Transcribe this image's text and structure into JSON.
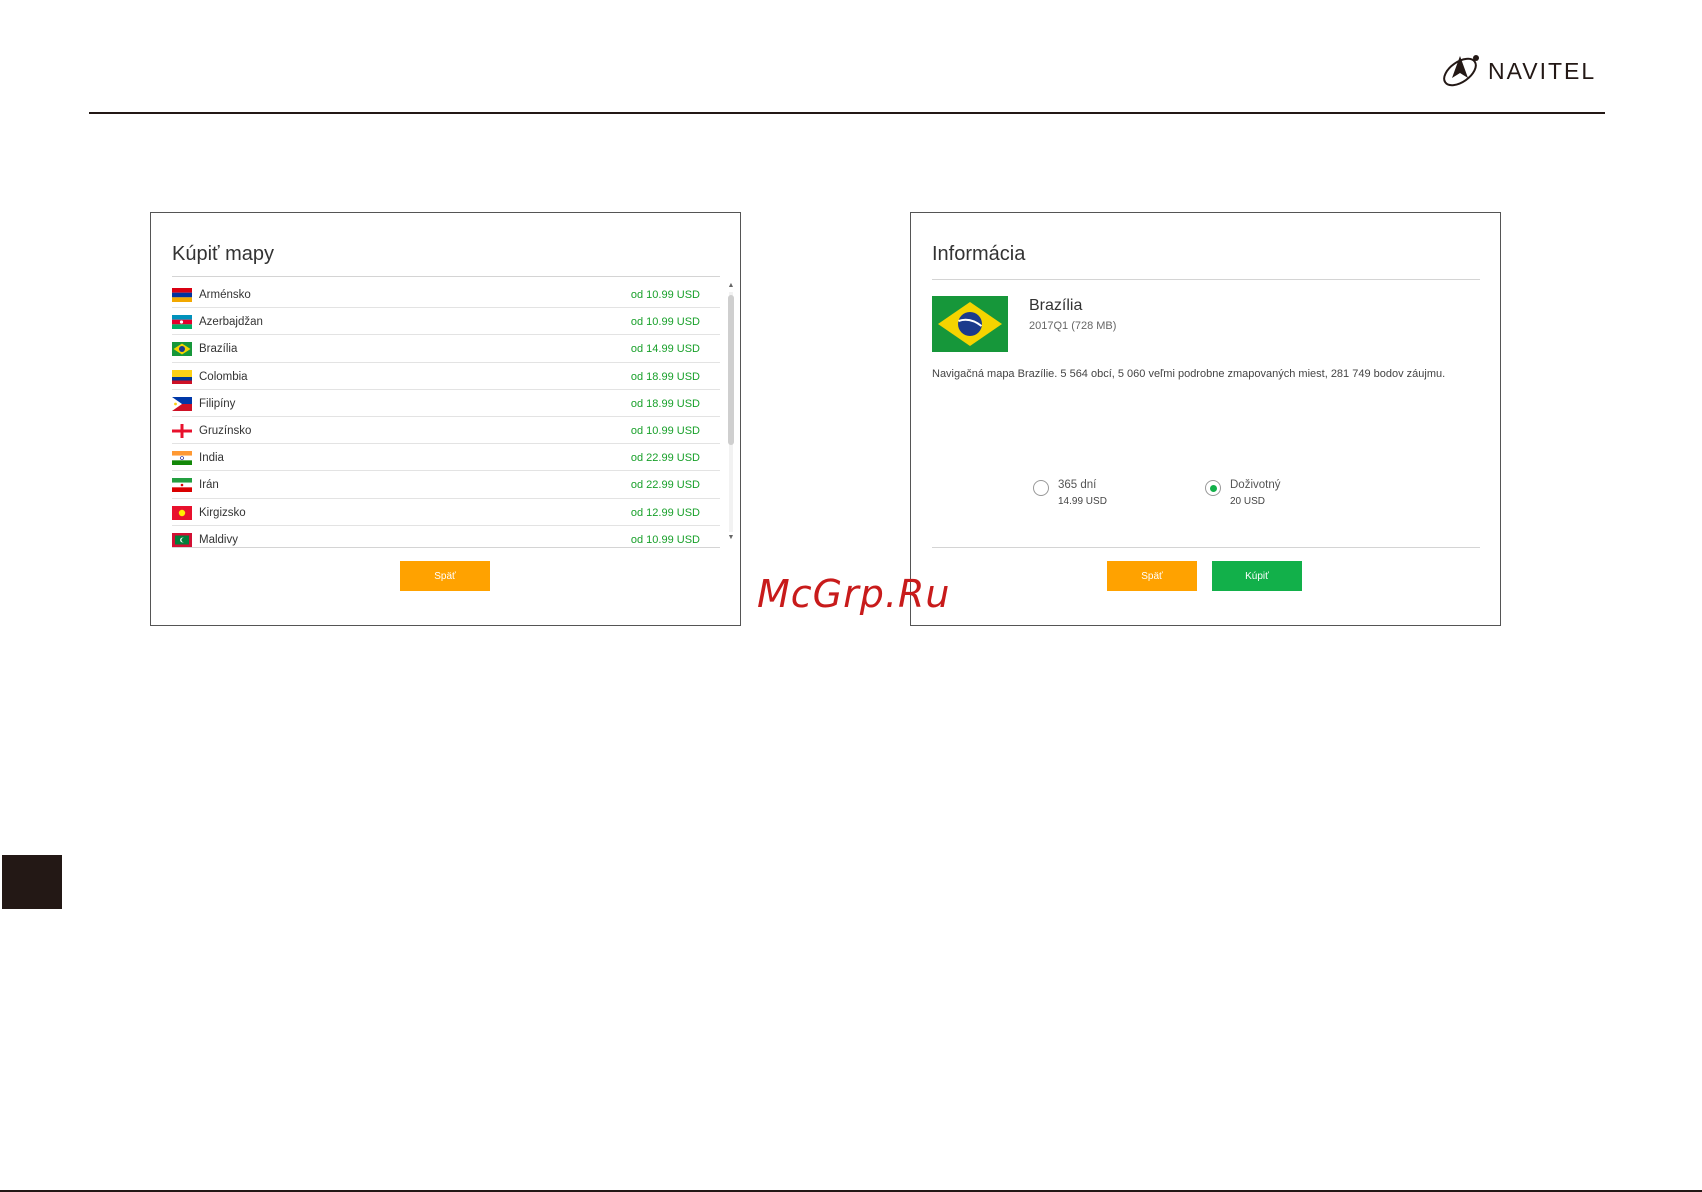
{
  "brand": {
    "name": "NAVITEL"
  },
  "watermark": "McGrp.Ru",
  "buy_maps": {
    "title": "Kúpiť mapy",
    "items": [
      {
        "country": "Arménsko",
        "price": "od 10.99 USD",
        "flag": "armenia"
      },
      {
        "country": "Azerbajdžan",
        "price": "od 10.99 USD",
        "flag": "azerbaijan"
      },
      {
        "country": "Brazília",
        "price": "od 14.99 USD",
        "flag": "brazil"
      },
      {
        "country": "Colombia",
        "price": "od 18.99 USD",
        "flag": "colombia"
      },
      {
        "country": "Filipíny",
        "price": "od 18.99 USD",
        "flag": "philippines"
      },
      {
        "country": "Gruzínsko",
        "price": "od 10.99 USD",
        "flag": "georgia"
      },
      {
        "country": "India",
        "price": "od 22.99 USD",
        "flag": "india"
      },
      {
        "country": "Irán",
        "price": "od 22.99 USD",
        "flag": "iran"
      },
      {
        "country": "Kirgizsko",
        "price": "od 12.99 USD",
        "flag": "kyrgyzstan"
      },
      {
        "country": "Maldivy",
        "price": "od 10.99 USD",
        "flag": "maldives"
      }
    ],
    "back_label": "Späť"
  },
  "info": {
    "title": "Informácia",
    "country": "Brazília",
    "version": "2017Q1 (728 MB)",
    "description": "Navigačná mapa Brazílie. 5 564 obcí, 5 060 veľmi podrobne zmapovaných miest, 281 749 bodov záujmu.",
    "options": [
      {
        "label": "365 dní",
        "price": "14.99 USD",
        "selected": false
      },
      {
        "label": "Doživotný",
        "price": "20 USD",
        "selected": true
      }
    ],
    "back_label": "Späť",
    "buy_label": "Kúpiť"
  },
  "colors": {
    "price_green": "#18a02a",
    "button_orange": "#ffa200",
    "button_green": "#12b04a",
    "watermark_red": "#c81b1b"
  }
}
